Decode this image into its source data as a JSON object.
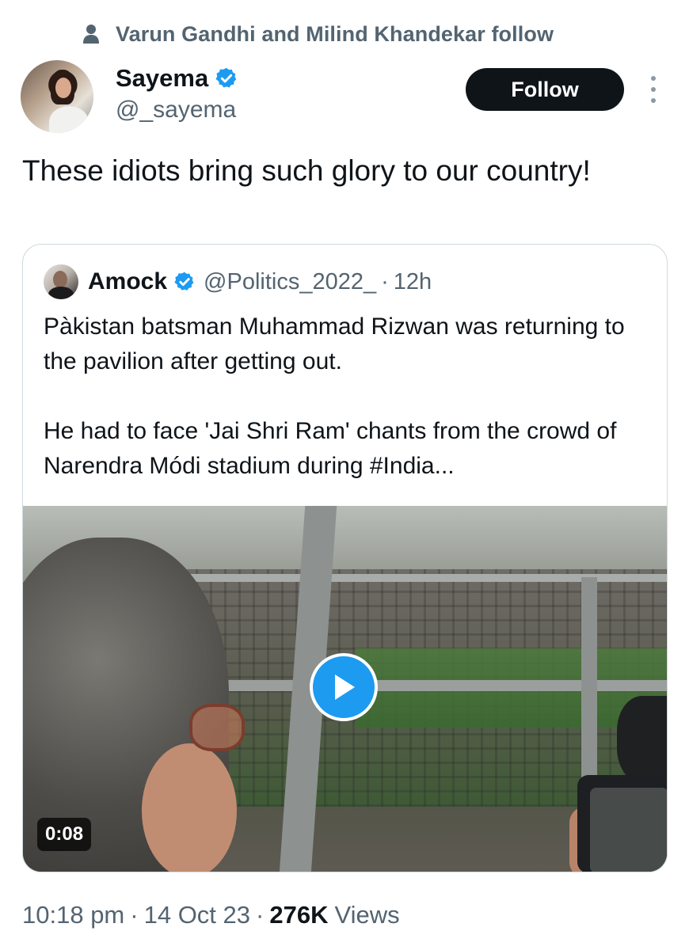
{
  "social_context": {
    "text": "Varun Gandhi and Milind Khandekar follow",
    "icon": "person-icon"
  },
  "author": {
    "name": "Sayema",
    "handle": "@_sayema",
    "verified": true,
    "verified_color": "#1d9bf0"
  },
  "follow_button": {
    "label": "Follow"
  },
  "more_menu": {
    "icon": "more-vertical-icon"
  },
  "tweet": {
    "text": "These idiots bring such glory to our country!"
  },
  "quote": {
    "name": "Amock",
    "verified": true,
    "handle": "@Politics_2022_",
    "separator": "·",
    "time": "12h",
    "paragraphs": [
      "Pàkistan batsman Muhammad Rizwan was returning to the pavilion after getting out.",
      "He had to face 'Jai Shri Ram' chants from the crowd of Narendra Módi stadium during #India..."
    ],
    "video": {
      "duration": "0:08",
      "play_icon": "play-icon"
    }
  },
  "meta": {
    "time": "10:18 pm",
    "sep": "·",
    "date": "14 Oct 23",
    "views_count": "276K",
    "views_label": "Views"
  },
  "colors": {
    "accent": "#1d9bf0",
    "text_primary": "#0f1419",
    "text_secondary": "#536471",
    "border": "#cfd9de"
  }
}
